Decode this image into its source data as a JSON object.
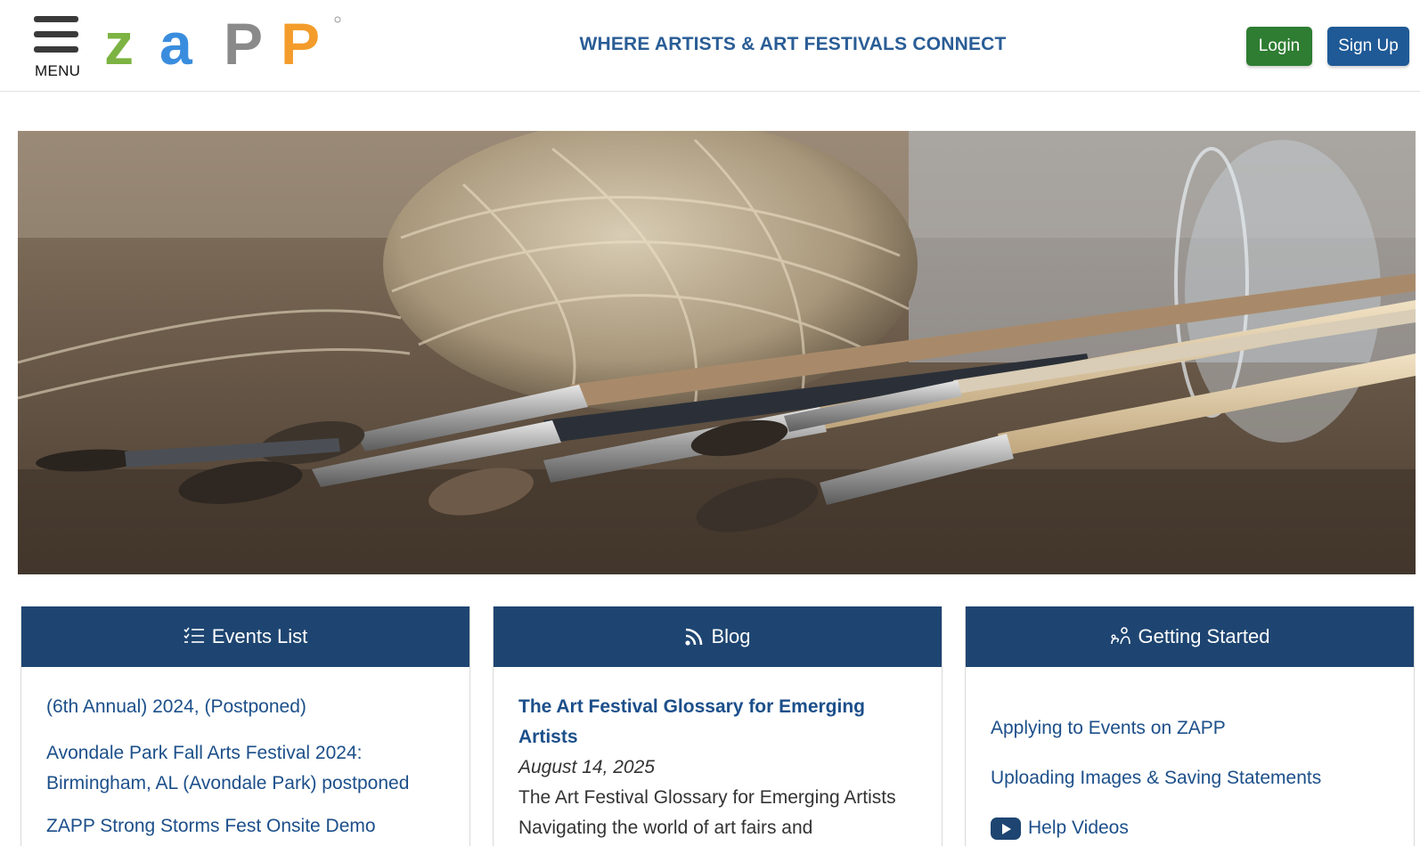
{
  "header": {
    "menu_label": "MENU",
    "logo_letters": [
      "Z",
      "A",
      "P",
      "P"
    ],
    "logo_colors": [
      "#7cb342",
      "#3a8dde",
      "#8a8a8a",
      "#f39c2b"
    ],
    "tagline": "WHERE ARTISTS & ART FESTIVALS CONNECT",
    "login_label": "Login",
    "signup_label": "Sign Up"
  },
  "hero": {
    "description_icon": "paint-brushes-twine-photo"
  },
  "events": {
    "title": "Events List",
    "icon": "list-check-icon",
    "items": [
      "(6th Annual) 2024, (Postponed)",
      "Avondale Park Fall Arts Festival 2024: Birmingham, AL (Avondale Park) postponed",
      "ZAPP Strong Storms Fest Onsite Demo"
    ]
  },
  "blog": {
    "title": "Blog",
    "icon": "rss-icon",
    "post_title": "The Art Festival Glossary for Emerging Artists",
    "post_date": "August 14, 2025",
    "post_excerpt": "The Art Festival Glossary for Emerging Artists Navigating the world of art fairs and"
  },
  "getting_started": {
    "title": "Getting Started",
    "icon": "user-path-icon",
    "links": [
      "Applying to Events on ZAPP",
      "Uploading Images & Saving Statements",
      "Help Videos"
    ]
  },
  "colors": {
    "header_blue": "#1e4571",
    "link_blue": "#1c4f8a",
    "login_green": "#2e7d32",
    "signup_blue": "#1f5a96"
  }
}
